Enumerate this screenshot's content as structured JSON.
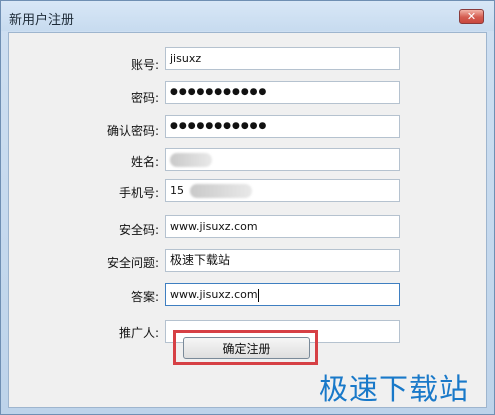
{
  "window": {
    "title": "新用户注册"
  },
  "form": {
    "fields": [
      {
        "label": "账号:",
        "value": "jisuxz"
      },
      {
        "label": "密码:",
        "value": "●●●●●●●●●●●"
      },
      {
        "label": "确认密码:",
        "value": "●●●●●●●●●●●"
      },
      {
        "label": "姓名:",
        "value": ""
      },
      {
        "label": "手机号:",
        "value": "15"
      },
      {
        "label": "安全码:",
        "value": "www.jisuxz.com"
      },
      {
        "label": "安全问题:",
        "value": "极速下载站"
      },
      {
        "label": "答案:",
        "value": "www.jisuxz.com"
      },
      {
        "label": "推广人:",
        "value": ""
      }
    ],
    "submit_label": "确定注册"
  },
  "watermark": "极速下载站",
  "icons": {
    "close": "close-icon"
  },
  "colors": {
    "highlight": "#d64045",
    "watermark": "#1979c9"
  }
}
